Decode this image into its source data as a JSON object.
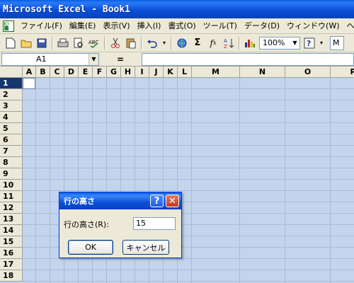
{
  "window": {
    "title": "Microsoft Excel - Book1"
  },
  "menu": {
    "items": [
      "ファイル(F)",
      "編集(E)",
      "表示(V)",
      "挿入(I)",
      "書式(O)",
      "ツール(T)",
      "データ(D)",
      "ウィンドウ(W)",
      "ヘルプ(H)"
    ]
  },
  "toolbar": {
    "zoom": "100%",
    "font_cut": "M",
    "buttons": [
      "new-icon",
      "open-icon",
      "save-icon",
      "print-icon",
      "print-preview-icon",
      "spelling-icon",
      "cut-icon",
      "paste-icon",
      "undo-icon",
      "hyperlink-icon",
      "autosum-icon",
      "function-icon",
      "sort-icon",
      "chart-icon",
      "help-icon"
    ]
  },
  "formula_bar": {
    "name_box": "A1",
    "equals": "=",
    "content": ""
  },
  "grid": {
    "columns": [
      "A",
      "B",
      "C",
      "D",
      "E",
      "F",
      "G",
      "H",
      "I",
      "J",
      "K",
      "L",
      "M",
      "N",
      "O",
      "P"
    ],
    "rows": [
      "1",
      "2",
      "3",
      "4",
      "5",
      "6",
      "7",
      "8",
      "9",
      "10",
      "11",
      "12",
      "13",
      "14",
      "15",
      "16",
      "17",
      "18"
    ],
    "active_cell": "A1"
  },
  "dialog": {
    "title": "行の高さ",
    "label": "行の高さ(R):",
    "value": "15",
    "ok": "OK",
    "cancel": "キャンセル",
    "help_glyph": "?",
    "close_glyph": "✕"
  }
}
